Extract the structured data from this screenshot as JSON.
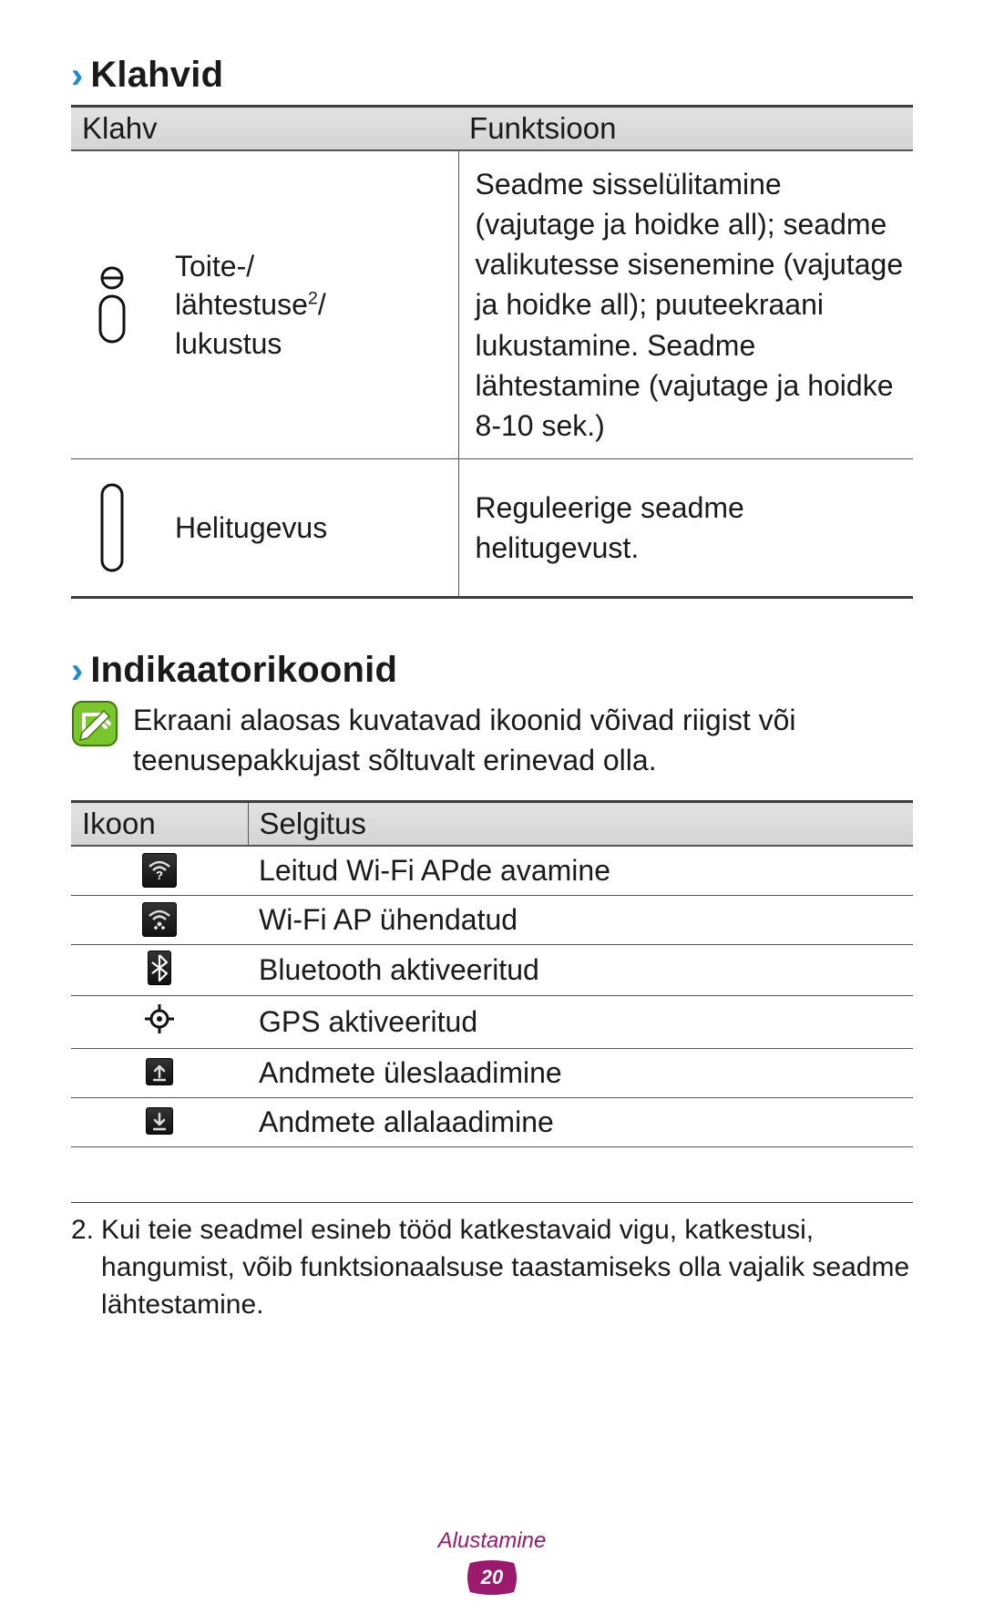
{
  "sections": {
    "keys": {
      "title": "Klahvid",
      "header_key": "Klahv",
      "header_function": "Funktsioon",
      "rows": [
        {
          "label_html": "Toite-/\nlähtestuse²/\nlukustus",
          "label_line1": "Toite-/",
          "label_line2_pre": "lähtestuse",
          "label_line2_sup": "2",
          "label_line2_post": "/",
          "label_line3": "lukustus",
          "function": "Seadme sisselülitamine (vajutage ja hoidke all); seadme valikutesse sisenemine (vajutage ja hoidke all); puuteekraani lukustamine. Seadme lähtestamine (vajutage ja hoidke 8-10 sek.)"
        },
        {
          "label": "Helitugevus",
          "function": "Reguleerige seadme helitugevust."
        }
      ]
    },
    "indicators": {
      "title": "Indikaatorikoonid",
      "note": "Ekraani alaosas kuvatavad ikoonid võivad riigist või teenusepakkujast sõltuvalt erinevad olla.",
      "header_icon": "Ikoon",
      "header_desc": "Selgitus",
      "rows": [
        {
          "icon": "wifi-question",
          "desc": "Leitud Wi-Fi APde avamine"
        },
        {
          "icon": "wifi-connected",
          "desc": "Wi-Fi AP ühendatud"
        },
        {
          "icon": "bluetooth",
          "desc": "Bluetooth aktiveeritud"
        },
        {
          "icon": "gps",
          "desc": "GPS aktiveeritud"
        },
        {
          "icon": "upload",
          "desc": "Andmete üleslaadimine"
        },
        {
          "icon": "download",
          "desc": "Andmete allalaadimine"
        }
      ]
    }
  },
  "footnote": {
    "num": "2.",
    "text": "Kui teie seadmel esineb tööd katkestavaid vigu, katkestusi, hangumist, võib funktsionaalsuse taastamiseks olla vajalik seadme lähtestamine."
  },
  "footer": {
    "section_name": "Alustamine",
    "page_number": "20"
  }
}
